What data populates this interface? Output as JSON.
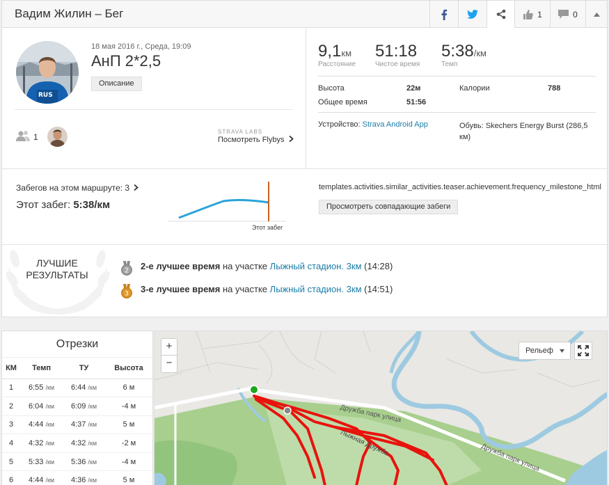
{
  "header": {
    "title": "Вадим Жилин – Бег",
    "kudos_count": "1",
    "comment_count": "0"
  },
  "activity": {
    "date": "18 мая 2016 г., Среда, 19:09",
    "name": "АнП 2*2,5",
    "description_button": "Описание",
    "kudos_count": "1",
    "strava_labs": "STRAVA LABS",
    "flybys": "Посмотреть Flybys"
  },
  "stats": {
    "distance_value": "9,1",
    "distance_unit": "км",
    "distance_label": "Расстояние",
    "moving_time_value": "51:18",
    "moving_time_label": "Чистое время",
    "pace_value": "5:38",
    "pace_unit": "/км",
    "pace_label": "Темп",
    "elevation_label": "Высота",
    "elevation_value": "22м",
    "elapsed_label": "Общее время",
    "elapsed_value": "51:56",
    "calories_label": "Калории",
    "calories_value": "788",
    "device_label": "Устройство:",
    "device_value": "Strava Android App",
    "shoes_label": "Обувь:",
    "shoes_value": "Skechers Energy Burst (286,5 км)"
  },
  "route": {
    "runs_text": "Забегов на этом маршруте: 3",
    "this_run_label": "Этот забег:",
    "this_run_value": "5:38/км",
    "marker_label": "Этот забег",
    "template_text": "templates.activities.similar_activities.teaser.achievement.frequency_milestone_html",
    "match_button": "Просмотреть совпадающие забеги"
  },
  "best": {
    "title": "Лучшие результаты",
    "items": [
      {
        "rank": "2",
        "bold": "2-е лучшее время",
        "mid": "на участке",
        "segment": "Лыжный стадион. 3км",
        "time": "(14:28)",
        "color": "#8a8a8a"
      },
      {
        "rank": "3",
        "bold": "3-е лучшее время",
        "mid": "на участке",
        "segment": "Лыжный стадион. 3км",
        "time": "(14:51)",
        "color": "#c8841e"
      }
    ]
  },
  "splits": {
    "title": "Отрезки",
    "headers": [
      "КМ",
      "Темп",
      "ТУ",
      "Высота"
    ],
    "unit": "/км",
    "rows": [
      {
        "km": "1",
        "pace": "6:55",
        "gap": "6:44",
        "elev": "6 м"
      },
      {
        "km": "2",
        "pace": "6:04",
        "gap": "6:09",
        "elev": "-4 м"
      },
      {
        "km": "3",
        "pace": "4:44",
        "gap": "4:37",
        "elev": "5 м"
      },
      {
        "km": "4",
        "pace": "4:32",
        "gap": "4:32",
        "elev": "-2 м"
      },
      {
        "km": "5",
        "pace": "5:33",
        "gap": "5:36",
        "elev": "-4 м"
      },
      {
        "km": "6",
        "pace": "4:44",
        "gap": "4:36",
        "elev": "5 м"
      }
    ]
  },
  "map": {
    "zoom_in": "+",
    "zoom_out": "−",
    "terrain": "Рельеф",
    "street1": "Дружба парк улица",
    "street2": "Дружба парк улица",
    "street3": "Лыжная Дружба",
    "route_color": "#e8130d",
    "start_color": "#1ea51e"
  },
  "colors": {
    "link": "#1a7da8",
    "facebook": "#3b5998",
    "twitter": "#1da1f2",
    "sparkline": "#2aa4d8",
    "marker": "#c8601e"
  }
}
